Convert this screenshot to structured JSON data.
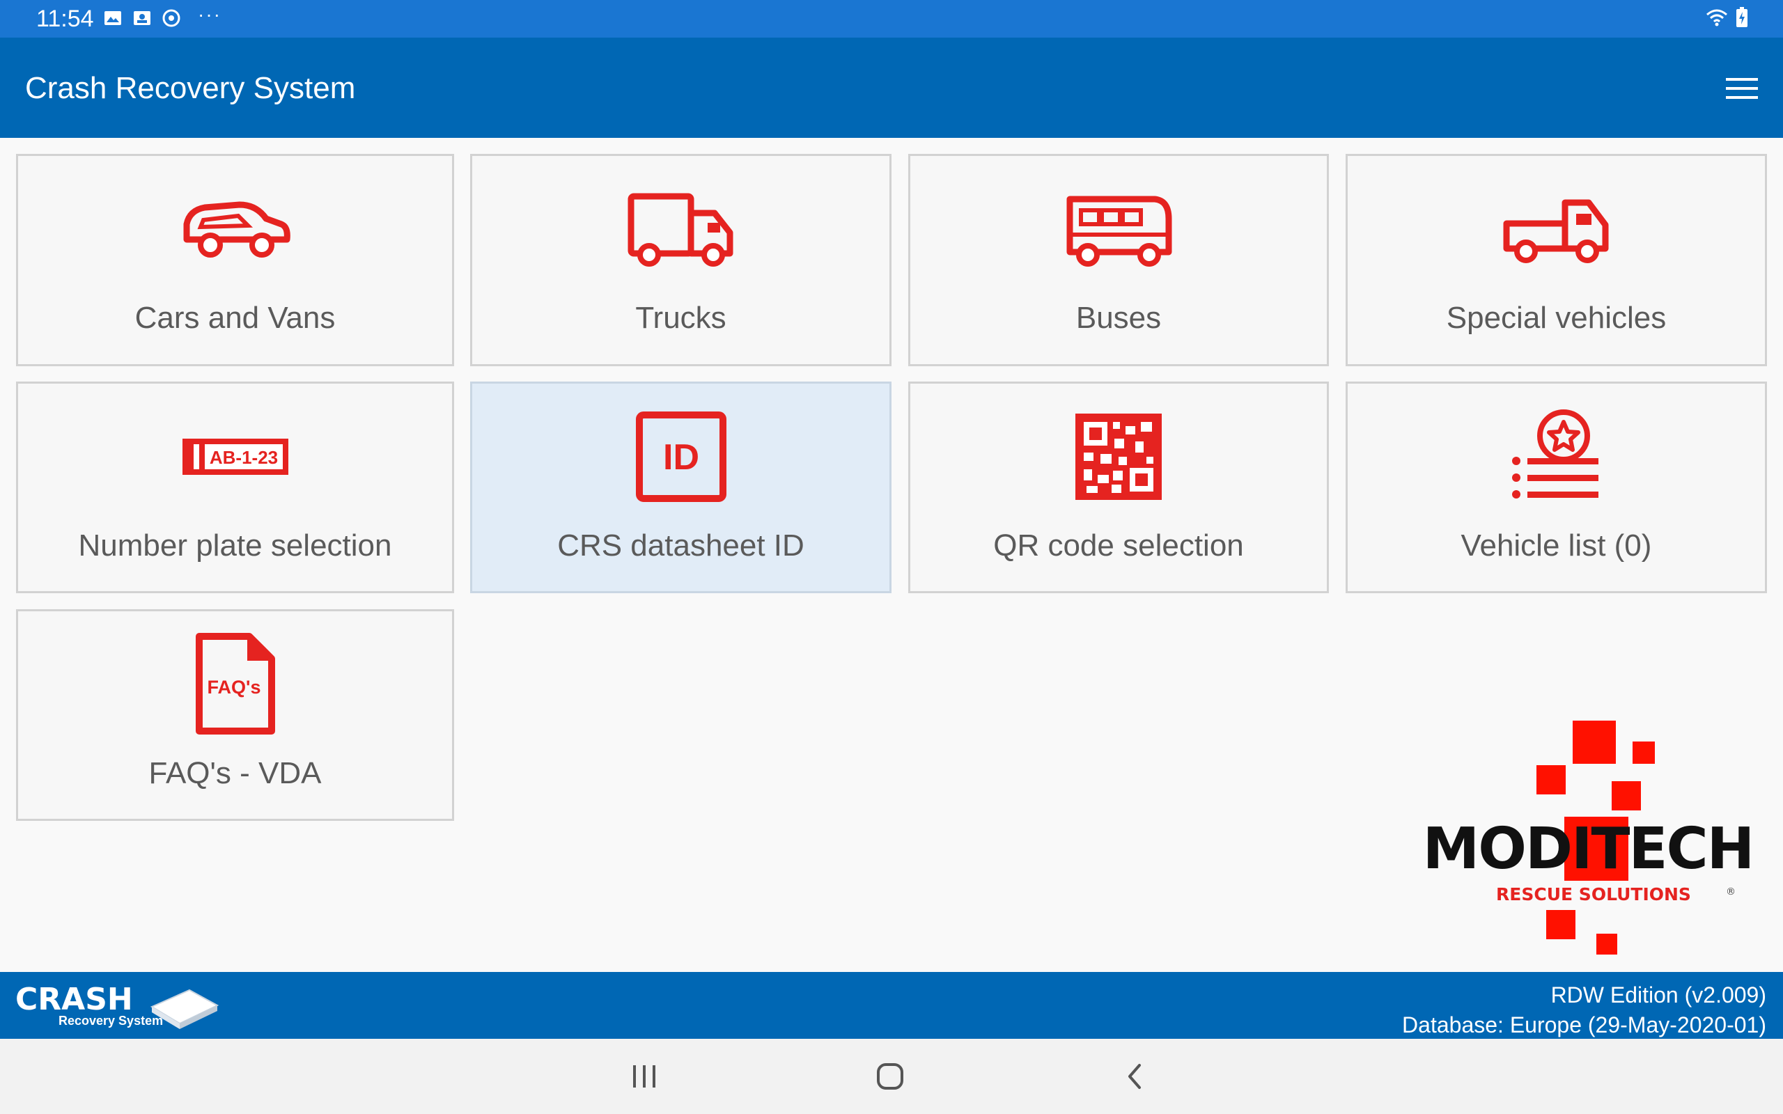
{
  "status_bar": {
    "time": "11:54",
    "left_icons": [
      "gallery-icon",
      "photo-icon",
      "chrome-icon"
    ],
    "more": "···",
    "right_icons": [
      "wifi-icon",
      "battery-charging-icon"
    ]
  },
  "app_bar": {
    "title": "Crash Recovery System",
    "menu_icon": "hamburger-menu-icon"
  },
  "tiles": [
    {
      "label": "Cars and Vans",
      "icon": "car-icon"
    },
    {
      "label": "Trucks",
      "icon": "truck-icon"
    },
    {
      "label": "Buses",
      "icon": "bus-icon"
    },
    {
      "label": "Special vehicles",
      "icon": "tow-truck-icon"
    },
    {
      "label": "Number plate selection",
      "icon": "number-plate-icon",
      "plate_text": "AB-1-23"
    },
    {
      "label": "CRS datasheet ID",
      "icon": "id-icon",
      "icon_text": "ID",
      "selected": true
    },
    {
      "label": "QR code selection",
      "icon": "qr-code-icon"
    },
    {
      "label": "Vehicle list (0)",
      "icon": "vehicle-list-icon"
    },
    {
      "label": "FAQ's - VDA",
      "icon": "faq-document-icon",
      "icon_text": "FAQ's"
    }
  ],
  "brand": {
    "name": "MODITECH",
    "tagline": "RESCUE SOLUTIONS",
    "registered": "®"
  },
  "footer": {
    "logo_word": "CRASH",
    "logo_sub": "Recovery System",
    "edition": "RDW Edition (v2.009)",
    "database": "Database: Europe (29-May-2020-01)"
  },
  "nav_bar": {
    "buttons": [
      "recent-apps-icon",
      "home-icon",
      "back-icon"
    ]
  },
  "colors": {
    "status_bar": "#1a76d2",
    "app_bar": "#0067b4",
    "icon_red": "#e52320",
    "selected_tile": "#e1ecf7"
  }
}
